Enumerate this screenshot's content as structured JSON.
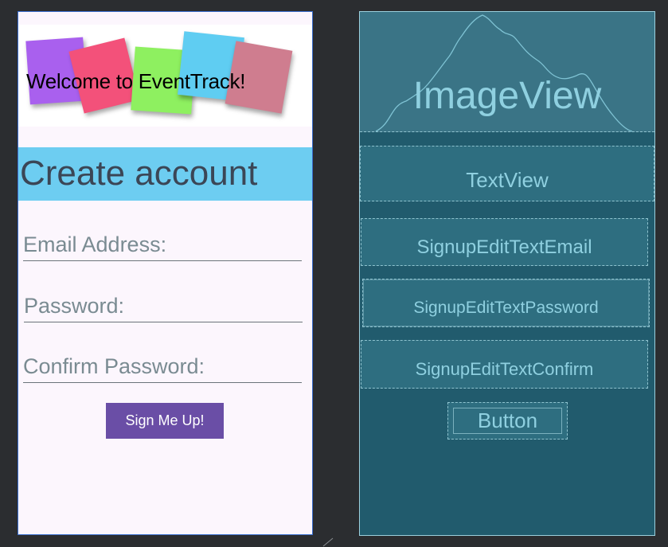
{
  "design": {
    "banner": {
      "text": "Welcome to EventTrack!"
    },
    "header": {
      "title": "Create account"
    },
    "fields": {
      "email_placeholder": "Email Address:",
      "password_placeholder": "Password:",
      "confirm_placeholder": "Confirm Password:"
    },
    "signup_button": "Sign Me Up!"
  },
  "blueprint": {
    "image_label": "ImageView",
    "textview_label": "TextView",
    "email_label": "SignupEditTextEmail",
    "password_label": "SignupEditTextPassword",
    "confirm_label": "SignupEditTextConfirm",
    "button_label": "Button"
  },
  "colors": {
    "canvas": "#2b2d30",
    "design_bg": "#fcf6fd",
    "header_bar": "#6dcdf1",
    "button": "#6a4ea6",
    "blueprint_bg": "#215b6d",
    "blueprint_text": "#8fd0e0"
  }
}
